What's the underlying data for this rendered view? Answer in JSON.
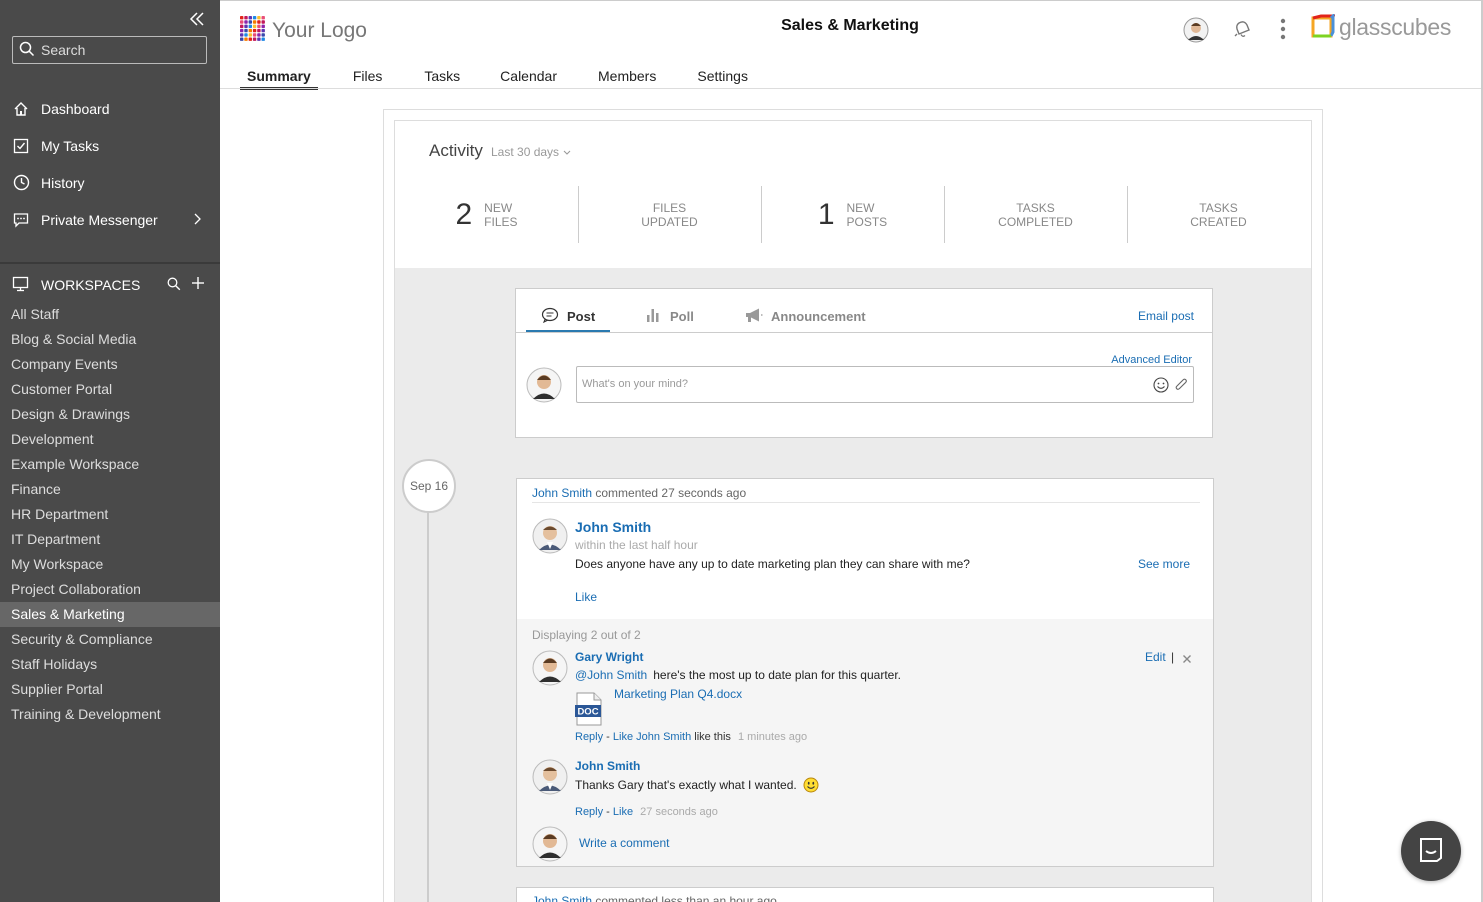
{
  "sidebar": {
    "search_placeholder": "Search",
    "nav": [
      {
        "label": "Dashboard",
        "icon": "home-icon"
      },
      {
        "label": "My Tasks",
        "icon": "checkbox-icon"
      },
      {
        "label": "History",
        "icon": "clock-icon"
      },
      {
        "label": "Private Messenger",
        "icon": "chat-icon"
      }
    ],
    "workspaces_label": "WORKSPACES",
    "workspaces": [
      "All Staff",
      "Blog & Social Media",
      "Company Events",
      "Customer Portal",
      "Design & Drawings",
      "Development",
      "Example Workspace",
      "Finance",
      "HR Department",
      "IT Department",
      "My Workspace",
      "Project Collaboration",
      "Sales & Marketing",
      "Security & Compliance",
      "Staff Holidays",
      "Supplier Portal",
      "Training & Development"
    ],
    "active_workspace": "Sales & Marketing"
  },
  "header": {
    "logo_text": "Your Logo",
    "title": "Sales & Marketing",
    "brand": "glasscubes",
    "tabs": [
      "Summary",
      "Files",
      "Tasks",
      "Calendar",
      "Members",
      "Settings"
    ],
    "active_tab": "Summary"
  },
  "activity": {
    "title": "Activity",
    "range": "Last 30 days",
    "stats": [
      {
        "num": "2",
        "line1": "NEW",
        "line2": "FILES"
      },
      {
        "num": "",
        "line1": "FILES",
        "line2": "UPDATED"
      },
      {
        "num": "1",
        "line1": "NEW",
        "line2": "POSTS"
      },
      {
        "num": "",
        "line1": "TASKS",
        "line2": "COMPLETED"
      },
      {
        "num": "",
        "line1": "TASKS",
        "line2": "CREATED"
      }
    ]
  },
  "composer": {
    "tabs": [
      "Post",
      "Poll",
      "Announcement"
    ],
    "email_post": "Email post",
    "advanced_editor": "Advanced Editor",
    "placeholder": "What's on your mind?"
  },
  "timeline": {
    "date": "Sep 16"
  },
  "post": {
    "meta_user": "John Smith",
    "meta_rest": "commented 27 seconds ago",
    "author": "John Smith",
    "time": "within the last half hour",
    "body": "Does anyone have any up to date marketing plan they can share with me?",
    "see_more": "See more",
    "like": "Like",
    "displaying": "Displaying 2 out of 2",
    "comments": [
      {
        "author": "Gary Wright",
        "mention": "@John Smith",
        "body": "here's the most up to date plan for this quarter.",
        "edit": "Edit",
        "bar": "|",
        "attachment": "Marketing Plan Q4.docx",
        "attachment_icon_label": "DOC",
        "reply": "Reply",
        "sep": " - ",
        "like": "Like",
        "liked_by": "John Smith",
        "liked_suffix": "like this",
        "time": "1 minutes ago"
      },
      {
        "author": "John Smith",
        "body": "Thanks Gary that's exactly what I wanted.",
        "reply": "Reply",
        "sep": " - ",
        "like": "Like",
        "time": "27 seconds ago"
      }
    ],
    "write_comment": "Write a comment"
  },
  "next_post": {
    "meta_user": "John Smith",
    "meta_rest": "commented less than an hour ago"
  },
  "colors": {
    "sidebar_bg": "#4a4a4a",
    "sidebar_active": "#676767",
    "link": "#1a6db3",
    "tab_accent": "#2a7ab0"
  }
}
